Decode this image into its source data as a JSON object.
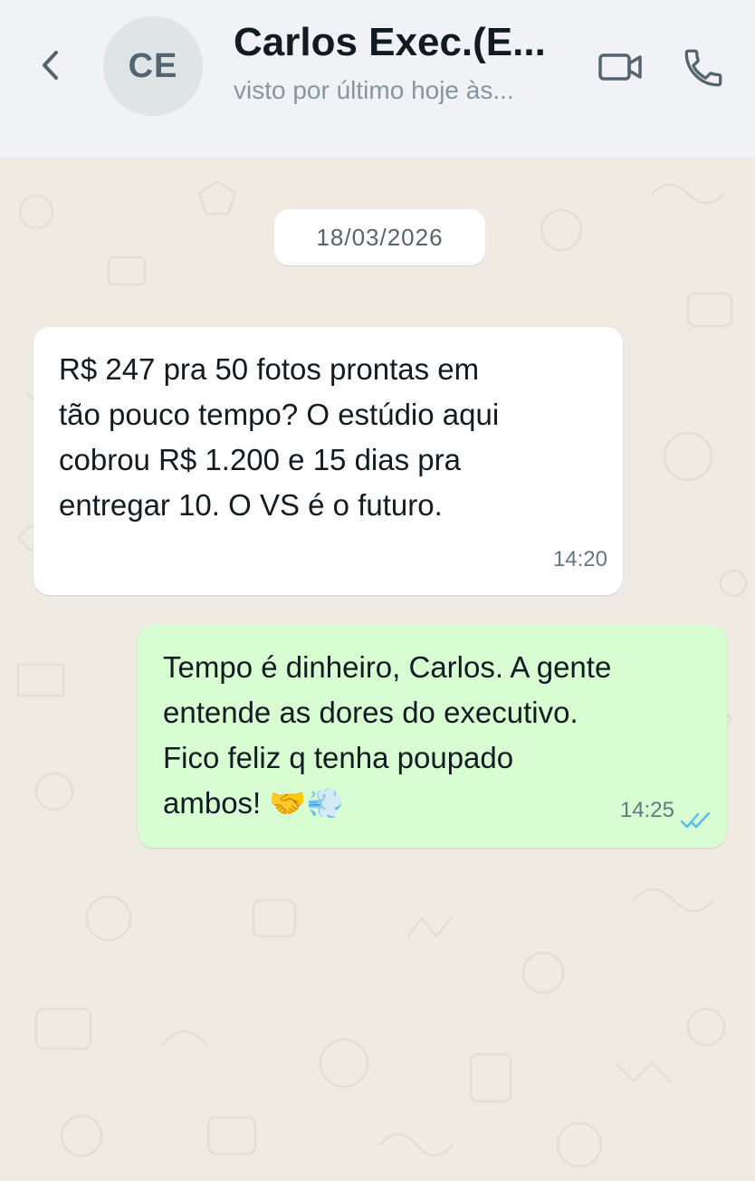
{
  "header": {
    "avatar_initials": "CE",
    "contact_name": "Carlos Exec.(E...",
    "status": "visto por último hoje às...",
    "icons": {
      "back": "chevron-left-icon",
      "video": "video-camera-icon",
      "call": "phone-icon"
    }
  },
  "chat": {
    "date_chip": "18/03/2026",
    "messages": [
      {
        "direction": "incoming",
        "text": "R$ 247 pra 50 fotos prontas em tão pouco tempo? O estúdio aqui cobrou R$ 1.200 e 15 dias pra entregar 10. O VS é o futuro.",
        "time": "14:20"
      },
      {
        "direction": "outgoing",
        "text": "Tempo é dinheiro, Carlos. A gente entende as dores do executivo. Fico feliz q tenha poupado ambos! 🤝💨",
        "time": "14:25",
        "status": "read"
      }
    ]
  },
  "colors": {
    "header_bg": "#f0f2f5",
    "chat_bg": "#efeae2",
    "incoming_bubble": "#ffffff",
    "outgoing_bubble": "#d9fdd3",
    "read_tick": "#53bdeb"
  }
}
